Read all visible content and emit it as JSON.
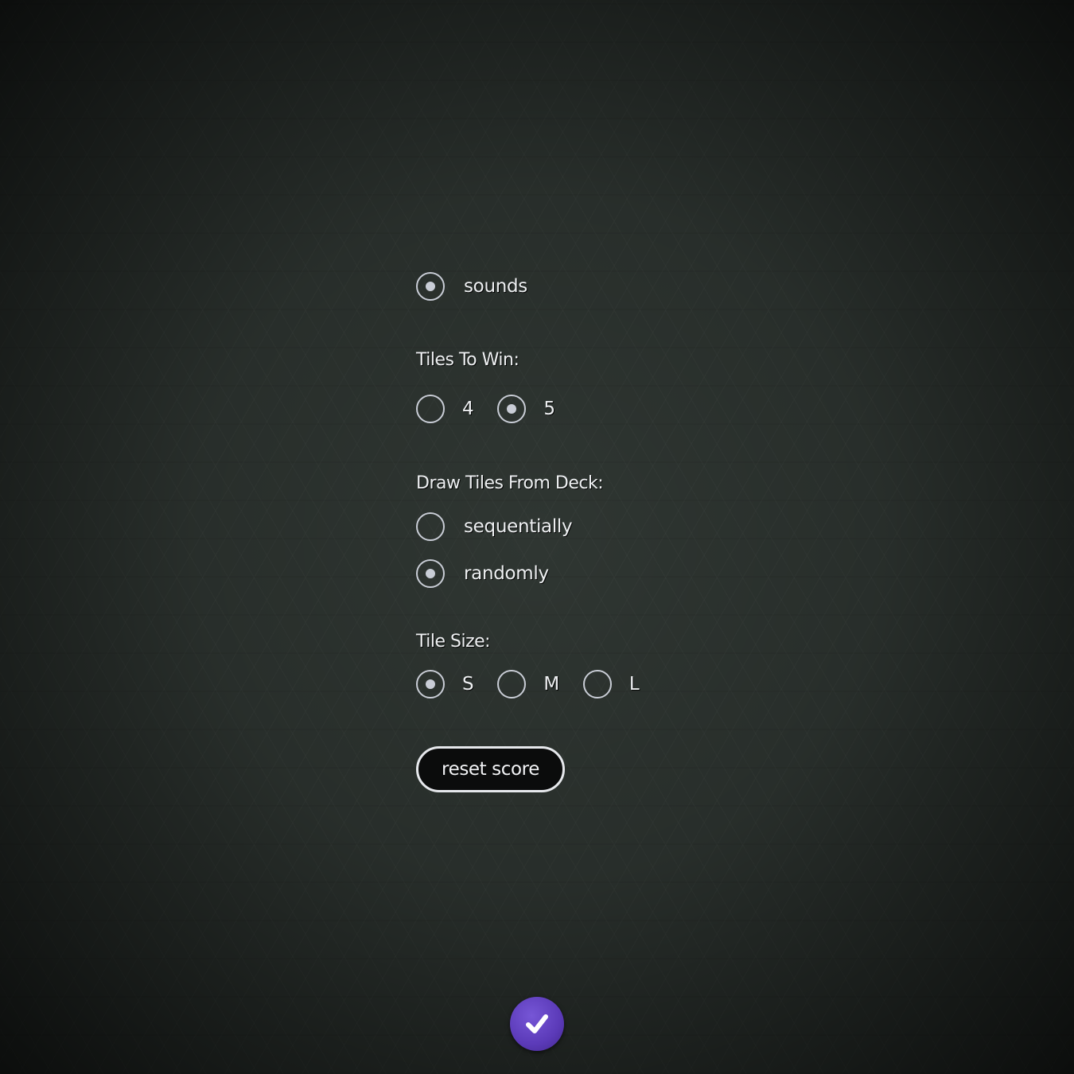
{
  "sounds": {
    "label": "sounds",
    "checked": true
  },
  "tiles_to_win": {
    "label": "Tiles To Win:",
    "options": [
      {
        "label": "4",
        "checked": false
      },
      {
        "label": "5",
        "checked": true
      }
    ]
  },
  "draw_tiles": {
    "label": "Draw Tiles From Deck:",
    "options": [
      {
        "label": "sequentially",
        "checked": false
      },
      {
        "label": "randomly",
        "checked": true
      }
    ]
  },
  "tile_size": {
    "label": "Tile Size:",
    "options": [
      {
        "label": "S",
        "checked": true
      },
      {
        "label": "M",
        "checked": false
      },
      {
        "label": "L",
        "checked": false
      }
    ]
  },
  "reset_button": {
    "label": "reset score"
  },
  "confirm_button": {
    "icon": "checkmark-icon",
    "color": "#5b3ab8"
  },
  "colors": {
    "background": "#2f3632",
    "radio": "#c9cdd6",
    "accent": "#5b3ab8"
  }
}
